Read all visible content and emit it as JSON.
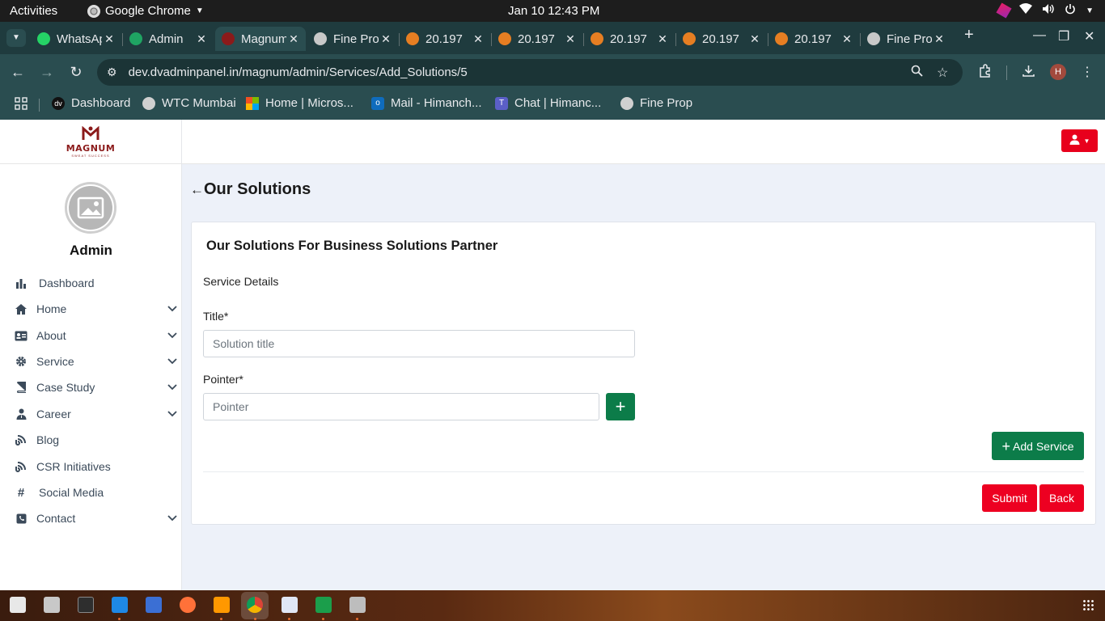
{
  "system": {
    "activities": "Activities",
    "app_name": "Google Chrome",
    "clock": "Jan 10  12:43 PM"
  },
  "tabs": [
    {
      "title": "WhatsApp",
      "favicon_color": "#25d366"
    },
    {
      "title": "Admin",
      "favicon_color": "#1fa463"
    },
    {
      "title": "Magnum",
      "favicon_color": "#8b1a1a"
    },
    {
      "title": "Fine Prop",
      "favicon_color": "#c8c8c8"
    },
    {
      "title": "20.197",
      "favicon_color": "#e67e22"
    },
    {
      "title": "20.197",
      "favicon_color": "#e67e22"
    },
    {
      "title": "20.197",
      "favicon_color": "#e67e22"
    },
    {
      "title": "20.197",
      "favicon_color": "#e67e22"
    },
    {
      "title": "20.197",
      "favicon_color": "#e67e22"
    },
    {
      "title": "Fine Prop",
      "favicon_color": "#c8c8c8"
    }
  ],
  "address_bar": {
    "url": "dev.dvadminpanel.in/magnum/admin/Services/Add_Solutions/5",
    "profile_initial": "H"
  },
  "bookmarks": [
    {
      "label": "Dashboard"
    },
    {
      "label": "WTC Mumbai"
    },
    {
      "label": "Home | Micros..."
    },
    {
      "label": "Mail - Himanch..."
    },
    {
      "label": "Chat | Himanc..."
    },
    {
      "label": "Fine Prop"
    }
  ],
  "sidebar": {
    "logo_text": "MAGNUM",
    "logo_tagline": "SWEAT SUCCESS",
    "user_name": "Admin",
    "items": [
      {
        "label": "Dashboard",
        "icon": "bar-chart-icon",
        "has_children": false
      },
      {
        "label": "Home",
        "icon": "home-icon",
        "has_children": true
      },
      {
        "label": "About",
        "icon": "id-card-icon",
        "has_children": true
      },
      {
        "label": "Service",
        "icon": "gear-icon",
        "has_children": true
      },
      {
        "label": "Case Study",
        "icon": "book-icon",
        "has_children": true
      },
      {
        "label": "Career",
        "icon": "user-tie-icon",
        "has_children": true
      },
      {
        "label": "Blog",
        "icon": "blog-icon",
        "has_children": false
      },
      {
        "label": "CSR Initiatives",
        "icon": "blog-icon",
        "has_children": false
      },
      {
        "label": "Social Media",
        "icon": "hashtag-icon",
        "has_children": false
      },
      {
        "label": "Contact",
        "icon": "phone-icon",
        "has_children": true
      }
    ]
  },
  "main": {
    "page_title": "Our Solutions",
    "card_title": "Our Solutions For Business Solutions Partner",
    "section_label": "Service Details",
    "title_label": "Title*",
    "title_placeholder": "Solution title",
    "title_value": "",
    "pointer_label": "Pointer*",
    "pointer_placeholder": "Pointer",
    "pointer_value": "",
    "add_service_label": "Add Service",
    "submit_label": "Submit",
    "back_label": "Back"
  },
  "colors": {
    "primary_green": "#0c7c49",
    "danger_red": "#ed0021",
    "brand_maroon": "#8b1a1a"
  }
}
